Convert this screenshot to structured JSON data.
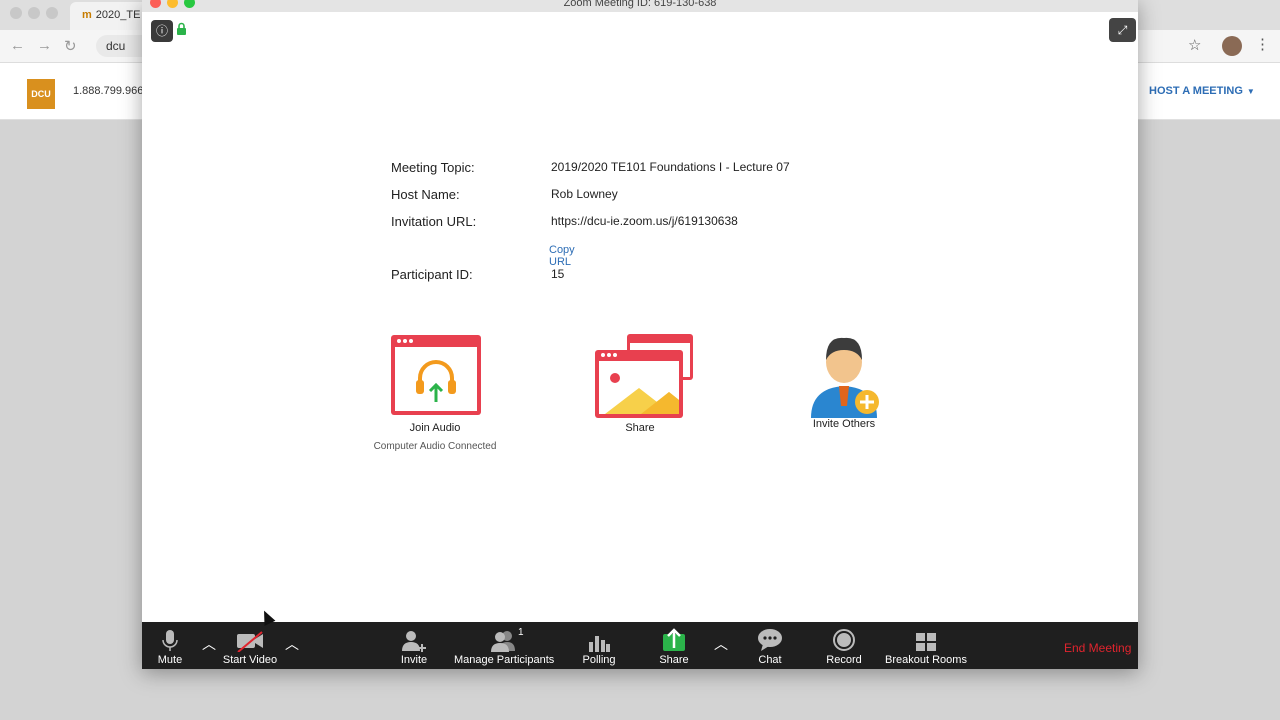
{
  "browser": {
    "tab_title": "2020_TE",
    "url_fragment": "dcu",
    "phone": "1.888.799.966",
    "host_meeting": "HOST A MEETING",
    "logo_text": "DCU"
  },
  "window": {
    "title": "Zoom Meeting ID: 619-130-638"
  },
  "meeting_info": {
    "topic_label": "Meeting Topic:",
    "topic_value": "2019/2020 TE101 Foundations I - Lecture 07",
    "host_label": "Host Name:",
    "host_value": "Rob Lowney",
    "url_label": "Invitation URL:",
    "url_value": "https://dcu-ie.zoom.us/j/619130638",
    "copy_url": "Copy URL",
    "participant_label": "Participant ID:",
    "participant_value": "15"
  },
  "tiles": {
    "join_audio": "Join Audio",
    "join_audio_sub": "Computer Audio Connected",
    "share": "Share",
    "invite_others": "Invite Others"
  },
  "toolbar": {
    "mute": "Mute",
    "start_video": "Start Video",
    "invite": "Invite",
    "manage_participants": "Manage Participants",
    "participant_count": "1",
    "polling": "Polling",
    "share": "Share",
    "chat": "Chat",
    "record": "Record",
    "breakout_rooms": "Breakout Rooms",
    "end_meeting": "End Meeting"
  },
  "colors": {
    "accent_red": "#e0242e",
    "link_blue": "#2d6db5",
    "share_green": "#2bb34a",
    "tile_red": "#e8404f"
  }
}
